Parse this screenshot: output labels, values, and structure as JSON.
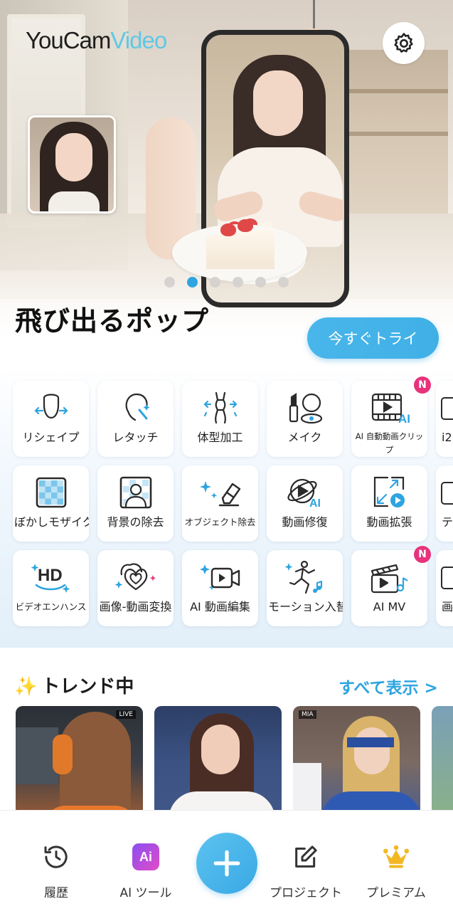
{
  "app": {
    "logo_part1": "YouCam",
    "logo_part2": "Video"
  },
  "hero": {
    "headline": "飛び出るポップ",
    "cta_label": "今すぐトライ",
    "carousel": {
      "total": 6,
      "active_index": 1
    }
  },
  "tools": [
    [
      {
        "label": "リシェイプ",
        "icon": "face-reshape-icon"
      },
      {
        "label": "レタッチ",
        "icon": "retouch-face-icon"
      },
      {
        "label": "体型加工",
        "icon": "body-shape-icon"
      },
      {
        "label": "メイク",
        "icon": "makeup-icon"
      },
      {
        "label": "AI 自動動画クリップ",
        "icon": "ai-video-clip-icon",
        "badge": "N"
      },
      {
        "label": "i2",
        "icon": "partial-tool-icon"
      }
    ],
    [
      {
        "label": "ぼかしモザイク",
        "icon": "mosaic-icon"
      },
      {
        "label": "背景の除去",
        "icon": "background-remove-icon"
      },
      {
        "label": "オブジェクト除去",
        "icon": "object-eraser-icon"
      },
      {
        "label": "動画修復",
        "icon": "ai-video-restore-icon"
      },
      {
        "label": "動画拡張",
        "icon": "video-expand-icon"
      },
      {
        "label": "テキ",
        "icon": "partial-tool-icon"
      }
    ],
    [
      {
        "label": "ビデオエンハンス",
        "icon": "hd-enhance-icon"
      },
      {
        "label": "画像-動画変換",
        "icon": "image-to-video-icon"
      },
      {
        "label": "AI 動画編集",
        "icon": "ai-video-edit-icon"
      },
      {
        "label": "モーション入替",
        "icon": "motion-swap-icon"
      },
      {
        "label": "AI MV",
        "icon": "ai-mv-icon",
        "badge": "N"
      },
      {
        "label": "画",
        "icon": "partial-tool-icon"
      }
    ]
  ],
  "trending": {
    "title": "トレンド中",
    "show_all": "すべて表示 >",
    "cards": [
      {
        "tag": "LIVE"
      },
      {
        "tag": ""
      },
      {
        "tag": "MIA"
      }
    ]
  },
  "nav": {
    "history": "履歴",
    "ai_tools": "AI ツール",
    "projects": "プロジェクト",
    "premium": "プレミアム"
  },
  "colors": {
    "accent": "#2ea4e0",
    "badge": "#e8327c",
    "premium": "#f2b823",
    "logo_video": "#5fc8e6"
  }
}
